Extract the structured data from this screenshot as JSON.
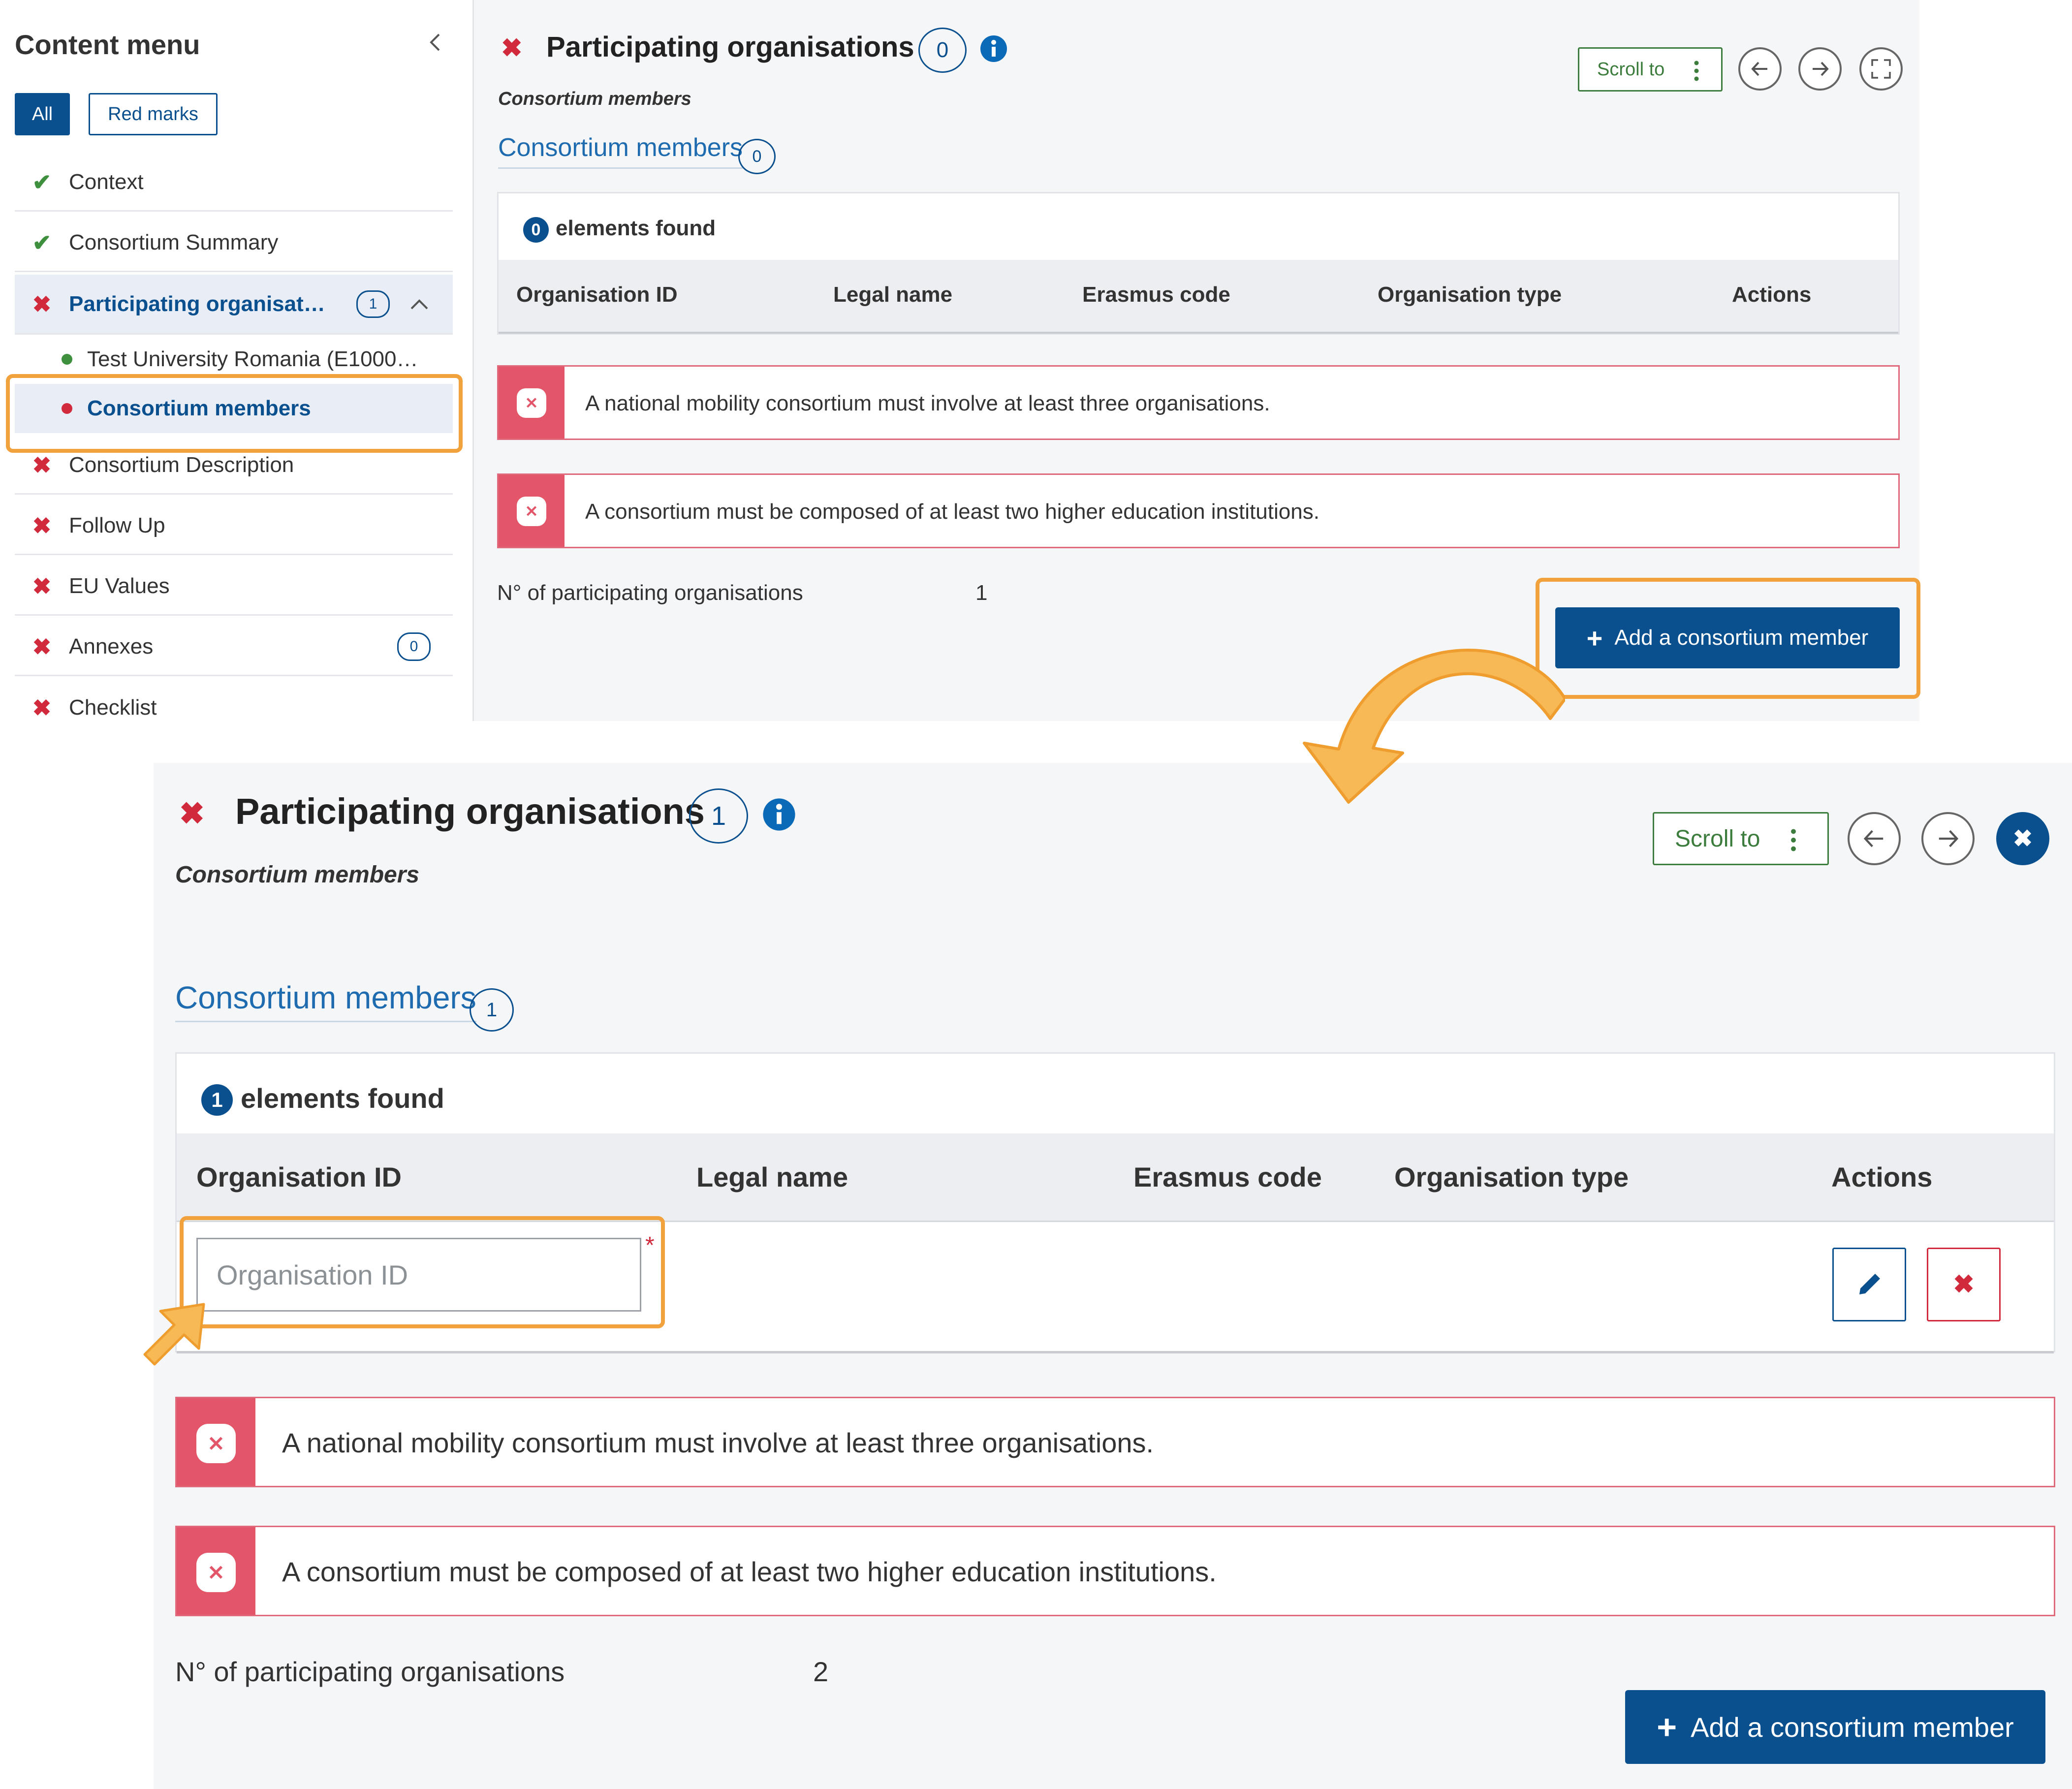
{
  "sidebar": {
    "title": "Content menu",
    "filters": {
      "all": "All",
      "red_marks": "Red marks"
    },
    "items": [
      {
        "label": "Context",
        "status": "ok"
      },
      {
        "label": "Consortium Summary",
        "status": "ok"
      },
      {
        "label": "Participating organisat…",
        "status": "error",
        "badge": "1"
      },
      {
        "label": "Consortium Description",
        "status": "error"
      },
      {
        "label": "Follow Up",
        "status": "error"
      },
      {
        "label": "EU Values",
        "status": "error"
      },
      {
        "label": "Annexes",
        "status": "error",
        "badge": "0"
      },
      {
        "label": "Checklist",
        "status": "error"
      }
    ],
    "subitems": [
      {
        "label": "Test University Romania (E1000…",
        "dot_color": "#3e8f3e"
      },
      {
        "label": "Consortium members",
        "dot_color": "#d12a3c"
      }
    ]
  },
  "top": {
    "title": "Participating organisations",
    "title_badge": "0",
    "caption": "Consortium members",
    "scroll_to": "Scroll to",
    "subsection": "Consortium members",
    "subsection_badge": "0",
    "found_count": "0",
    "found_label": "elements found",
    "columns": [
      "Organisation ID",
      "Legal name",
      "Erasmus code",
      "Organisation type",
      "Actions"
    ],
    "errors": [
      "A national mobility consortium must involve at least three organisations.",
      "A consortium must be composed of at least two higher education institutions."
    ],
    "count_label": "N° of participating organisations",
    "count_value": "1",
    "add_button": "Add a consortium member"
  },
  "bottom": {
    "title": "Participating organisations",
    "title_badge": "1",
    "caption": "Consortium members",
    "scroll_to": "Scroll to",
    "subsection": "Consortium members",
    "subsection_badge": "1",
    "found_count": "1",
    "found_label": "elements found",
    "columns": [
      "Organisation ID",
      "Legal name",
      "Erasmus code",
      "Organisation type",
      "Actions"
    ],
    "row": {
      "org_id_placeholder": "Organisation ID",
      "required_mark": "*"
    },
    "errors": [
      "A national mobility consortium must involve at least three organisations.",
      "A consortium must be composed of at least two higher education institutions."
    ],
    "count_label": "N° of participating organisations",
    "count_value": "2",
    "add_button": "Add a consortium member"
  },
  "colors": {
    "primary": "#0a4f8e",
    "error": "#d12a3c",
    "error_panel": "#e3566a",
    "success": "#3e8f3e",
    "highlight": "#f2a23c"
  },
  "icons": {
    "collapse": "chevron-left-icon",
    "expand": "chevron-up-icon",
    "info": "info-icon",
    "prev": "arrow-left-icon",
    "next": "arrow-right-icon",
    "fullscreen": "fullscreen-icon",
    "close": "close-icon",
    "edit": "pencil-icon",
    "delete": "delete-icon",
    "kebab": "kebab-icon"
  }
}
